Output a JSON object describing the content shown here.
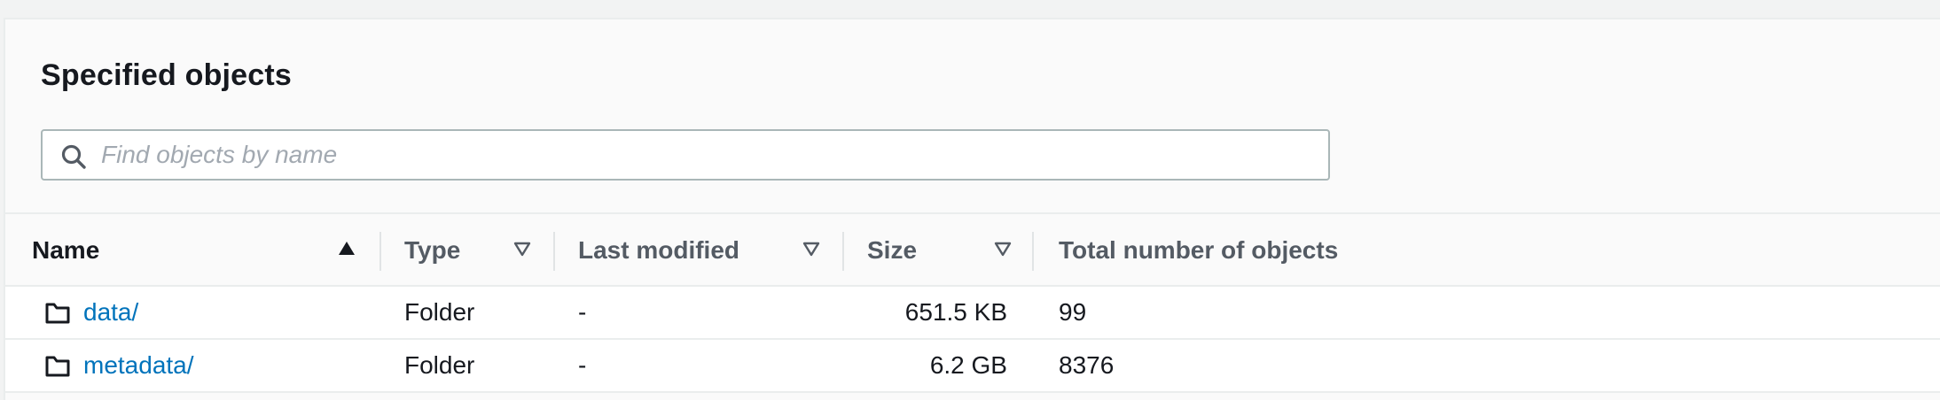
{
  "panel": {
    "title": "Specified objects"
  },
  "search": {
    "placeholder": "Find objects by name",
    "value": ""
  },
  "table": {
    "columns": [
      {
        "key": "name",
        "label": "Name",
        "sort": "ascending"
      },
      {
        "key": "type",
        "label": "Type",
        "sort": "none"
      },
      {
        "key": "last_modified",
        "label": "Last modified",
        "sort": "none"
      },
      {
        "key": "size",
        "label": "Size",
        "sort": "none"
      },
      {
        "key": "total_objects",
        "label": "Total number of objects",
        "sort": "none"
      }
    ],
    "rows": [
      {
        "icon": "folder-icon",
        "name": "data/",
        "type": "Folder",
        "last_modified": "-",
        "size": "651.5 KB",
        "total_objects": "99"
      },
      {
        "icon": "folder-icon",
        "name": "metadata/",
        "type": "Folder",
        "last_modified": "-",
        "size": "6.2 GB",
        "total_objects": "8376"
      }
    ]
  },
  "colors": {
    "link": "#0073bb",
    "text": "#16191f",
    "header_text": "#545b64",
    "border": "#eaeded"
  }
}
